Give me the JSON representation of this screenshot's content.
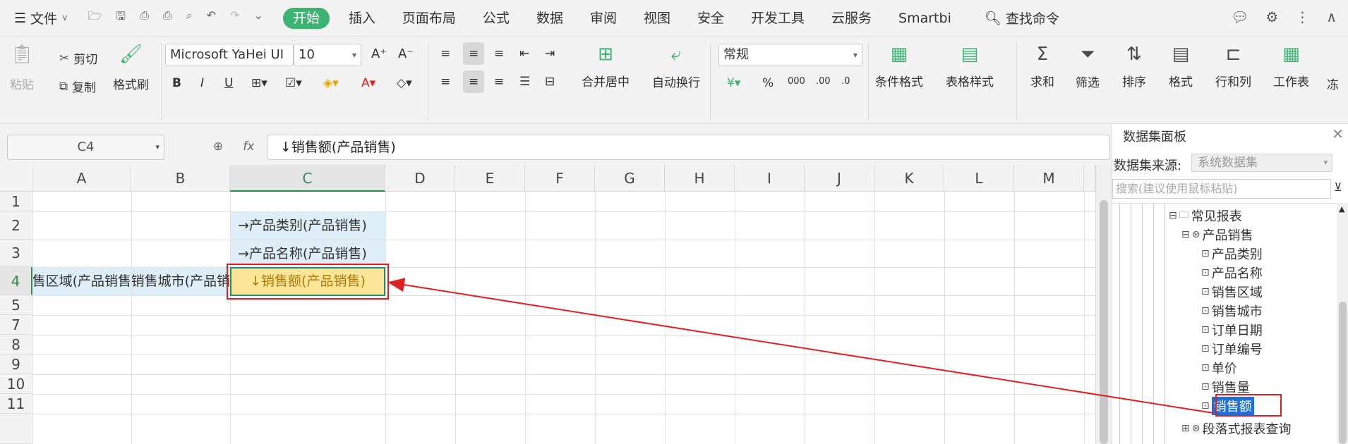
{
  "topbar": {
    "file_menu": "文件",
    "tabs": [
      "开始",
      "插入",
      "页面布局",
      "公式",
      "数据",
      "审阅",
      "视图",
      "安全",
      "开发工具",
      "云服务",
      "Smartbi"
    ],
    "search_command": "查找命令"
  },
  "ribbon": {
    "paste": "粘贴",
    "cut": "剪切",
    "copy": "复制",
    "format_painter": "格式刷",
    "font_name": "Microsoft YaHei UI",
    "font_size": "10",
    "number_format": "常规",
    "merge_center": "合并居中",
    "wrap_text": "自动换行",
    "conditional_format": "条件格式",
    "table_style": "表格样式",
    "sum": "求和",
    "filter": "筛选",
    "sort": "排序",
    "format": "格式",
    "row_col": "行和列",
    "worksheet": "工作表",
    "more": "冻"
  },
  "formula": {
    "cell_ref": "C4",
    "content": "↓销售额(产品销售)"
  },
  "grid": {
    "columns": [
      "A",
      "B",
      "C",
      "D",
      "E",
      "F",
      "G",
      "H",
      "I",
      "J",
      "K",
      "L",
      "M"
    ],
    "rows": [
      "1",
      "2",
      "3",
      "4",
      "5",
      "7",
      "8",
      "9",
      "10",
      "11"
    ],
    "cells": {
      "C2": "→产品类别(产品销售)",
      "C3": "→产品名称(产品销售)",
      "A4": "销售区域(产品销售",
      "B4": "销售城市(产品销",
      "C4": "↓销售额(产品销售)"
    }
  },
  "panel": {
    "title": "数据集面板",
    "source_label": "数据集来源:",
    "source_value": "系统数据集",
    "search_placeholder": "搜索(建议使用鼠标粘贴)",
    "tree": {
      "folder": "常见报表",
      "dataset": "产品销售",
      "fields": [
        "产品类别",
        "产品名称",
        "销售区域",
        "销售城市",
        "订单日期",
        "订单编号",
        "单价",
        "销售量",
        "销售额"
      ],
      "next": "段落式报表查询"
    }
  },
  "colors": {
    "accent": "#3cb371",
    "highlight": "#e02020",
    "selected": "#1e6fd9"
  }
}
